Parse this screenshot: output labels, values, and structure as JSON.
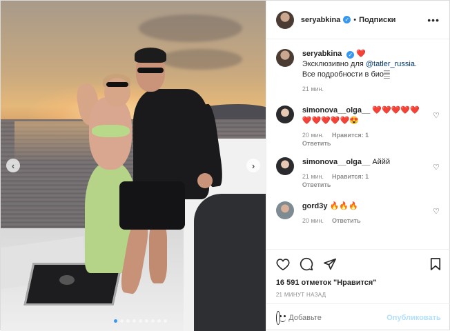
{
  "post": {
    "carousel_dots": 9,
    "active_dot": 0
  },
  "header": {
    "username": "seryabkina",
    "separator": "•",
    "follow_label": "Подписки",
    "more": "•••"
  },
  "caption": {
    "username": "seryabkina",
    "heart": "❤️",
    "text_prefix": "Эксклюзивно для ",
    "mention": "@tatler_russia",
    "text_suffix": ".",
    "line2": "Все подробности в био𝄛",
    "time": "21 мин."
  },
  "comments": [
    {
      "username": "simonova__olga__",
      "text": "❤️❤️❤️❤️❤️❤️❤️❤️❤️❤️😍",
      "time": "20 мин.",
      "likes": "Нравится: 1",
      "reply": "Ответить"
    },
    {
      "username": "simonova__olga__",
      "text": "Аййй",
      "time": "21 мин.",
      "likes": "Нравится: 1",
      "reply": "Ответить"
    },
    {
      "username": "gord3y",
      "text": "🔥🔥🔥",
      "time": "20 мин.",
      "likes": "",
      "reply": "Ответить"
    }
  ],
  "actions": {
    "likes_text": "16 591 отметок \"Нравится\"",
    "timestamp": "21 МИНУТ НАЗАД"
  },
  "add_comment": {
    "placeholder": "Добавьте",
    "publish": "Опубликовать"
  },
  "colors": {
    "accent": "#3897f0",
    "publish_disabled": "#b2dffc",
    "muted": "#8e8e8e"
  }
}
